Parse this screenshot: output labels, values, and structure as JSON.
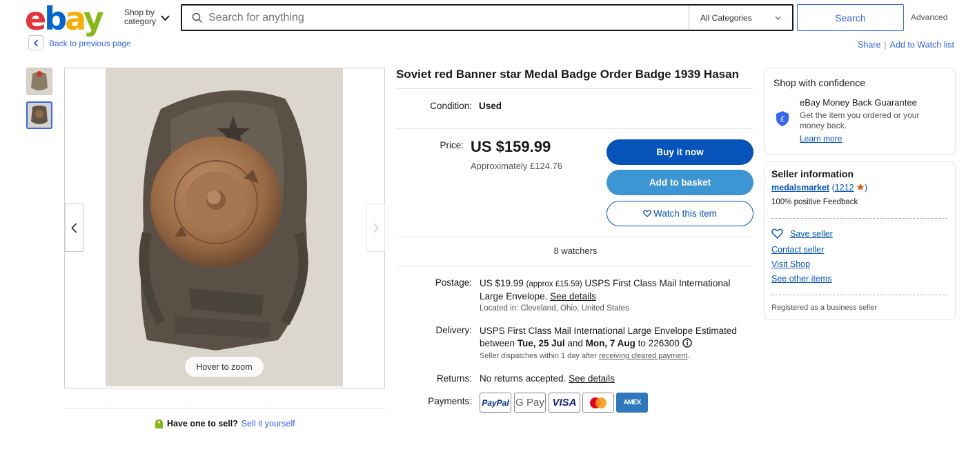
{
  "header": {
    "logo": {
      "e": "e",
      "b": "b",
      "a": "a",
      "y": "y"
    },
    "shop_by_line1": "Shop by",
    "shop_by_line2": "category",
    "search_placeholder": "Search for anything",
    "category": "All Categories",
    "search_button": "Search",
    "advanced": "Advanced"
  },
  "nav": {
    "back": "Back to previous page",
    "share": "Share",
    "watch_list": "Add to Watch list"
  },
  "gallery": {
    "zoom_hint": "Hover to zoom",
    "sell_question": "Have one to sell?",
    "sell_link": "Sell it yourself"
  },
  "item": {
    "title": "Soviet red Banner star Medal Badge Order Badge 1939 Hasan",
    "condition_label": "Condition:",
    "condition": "Used",
    "price_label": "Price:",
    "price": "US $159.99",
    "price_approx": "Approximately £124.76",
    "buy_now": "Buy it now",
    "add_basket": "Add to basket",
    "watch_item": "Watch this item",
    "watchers": "8 watchers",
    "postage_label": "Postage:",
    "postage_price": "US $19.99",
    "postage_approx": "(approx £15.59)",
    "postage_method": "USPS First Class Mail International Large Envelope.",
    "see_details": "See details",
    "location": "Located in: Cleveland, Ohio, United States",
    "delivery_label": "Delivery:",
    "delivery_text1": "USPS First Class Mail International Large Envelope Estimated between",
    "delivery_from": "Tue, 25 Jul",
    "delivery_and": "and",
    "delivery_to": "Mon, 7 Aug",
    "delivery_zip": "to 226300",
    "dispatch": "Seller dispatches within 1 day after",
    "dispatch_link": "receiving cleared payment",
    "returns_label": "Returns:",
    "returns": "No returns accepted.",
    "payments_label": "Payments:",
    "payment_methods": [
      "PayPal",
      "G Pay",
      "VISA",
      "Mastercard",
      "AMEX"
    ]
  },
  "confidence": {
    "title": "Shop with confidence",
    "mbg_title": "eBay Money Back Guarantee",
    "mbg_text": "Get the item you ordered or your money back.",
    "learn_more": "Learn more"
  },
  "seller": {
    "title": "Seller information",
    "name": "medalsmarket",
    "feedback_count": "1212",
    "positive": "100% positive Feedback",
    "save": "Save seller",
    "contact": "Contact seller",
    "visit": "Visit Shop",
    "other": "See other items",
    "registered": "Registered as a business seller"
  },
  "colors": {
    "primary_button": "#0654ba",
    "basket_button": "#3d96d4",
    "link": "#3665f3"
  }
}
